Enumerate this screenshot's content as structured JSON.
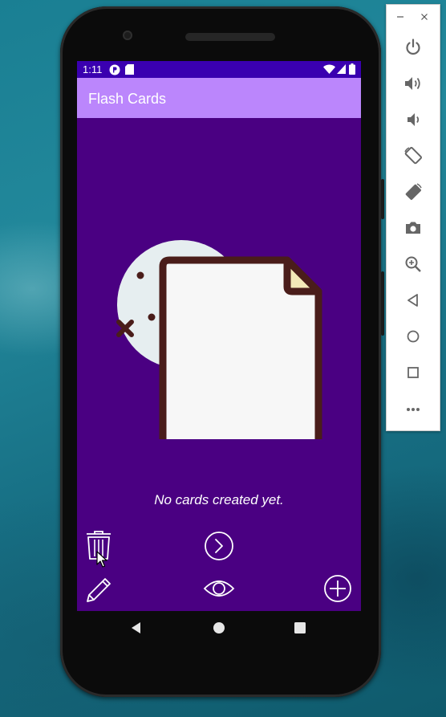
{
  "status_bar": {
    "time": "1:11"
  },
  "app_bar": {
    "title": "Flash Cards"
  },
  "empty_state": {
    "message": "No cards created yet."
  },
  "colors": {
    "status_bar": "#3a00b0",
    "app_bar": "#bb86fc",
    "background": "#4a0082",
    "card_outline": "#4a1d1a",
    "card_fill": "#f7f7f7",
    "card_fold": "#f3e8b8",
    "circle": "#e6eef0"
  },
  "controls": {
    "delete": "trash-icon",
    "next": "chevron-right-circle-icon",
    "edit": "pencil-icon",
    "view": "eye-icon",
    "add": "plus-circle-icon"
  },
  "emulator_panel": {
    "window_buttons": [
      "minimize-icon",
      "close-icon"
    ],
    "buttons": [
      "power-icon",
      "volume-up-icon",
      "volume-down-icon",
      "rotate-left-icon",
      "rotate-right-icon",
      "camera-icon",
      "zoom-icon",
      "back-icon",
      "home-icon",
      "overview-icon",
      "more-icon"
    ]
  },
  "nav_bar": [
    "back-icon",
    "home-icon",
    "overview-icon"
  ]
}
